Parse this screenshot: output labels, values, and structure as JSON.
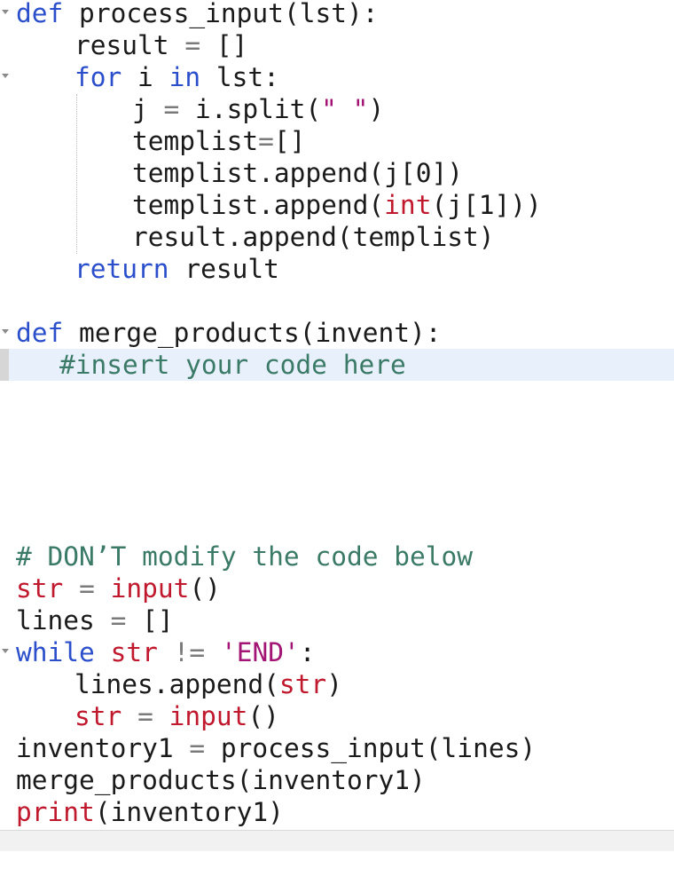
{
  "editor": {
    "lines": [
      {
        "id": 1,
        "tokens": [
          {
            "t": "kw",
            "v": "def"
          },
          {
            "t": "tx",
            "v": " process_input(lst):"
          }
        ]
      },
      {
        "id": 2,
        "tokens": [
          {
            "t": "tx",
            "v": "result "
          },
          {
            "t": "op",
            "v": "="
          },
          {
            "t": "tx",
            "v": " []"
          }
        ]
      },
      {
        "id": 3,
        "tokens": [
          {
            "t": "kw",
            "v": "for"
          },
          {
            "t": "tx",
            "v": " i "
          },
          {
            "t": "kw",
            "v": "in"
          },
          {
            "t": "tx",
            "v": " lst:"
          }
        ]
      },
      {
        "id": 4,
        "tokens": [
          {
            "t": "tx",
            "v": "j "
          },
          {
            "t": "op",
            "v": "="
          },
          {
            "t": "tx",
            "v": " i.split("
          },
          {
            "t": "str",
            "v": "\" \""
          },
          {
            "t": "tx",
            "v": ")"
          }
        ]
      },
      {
        "id": 5,
        "tokens": [
          {
            "t": "tx",
            "v": "templist"
          },
          {
            "t": "op",
            "v": "="
          },
          {
            "t": "tx",
            "v": "[]"
          }
        ]
      },
      {
        "id": 6,
        "tokens": [
          {
            "t": "tx",
            "v": "templist.append(j[0])"
          }
        ]
      },
      {
        "id": 7,
        "tokens": [
          {
            "t": "tx",
            "v": "templist.append("
          },
          {
            "t": "fn",
            "v": "int"
          },
          {
            "t": "tx",
            "v": "(j[1]))"
          }
        ]
      },
      {
        "id": 8,
        "tokens": [
          {
            "t": "tx",
            "v": "result.append(templist)"
          }
        ]
      },
      {
        "id": 9,
        "tokens": [
          {
            "t": "kw",
            "v": "return"
          },
          {
            "t": "tx",
            "v": " result"
          }
        ]
      },
      {
        "id": 10,
        "tokens": [
          {
            "t": "kw",
            "v": "def"
          },
          {
            "t": "tx",
            "v": " merge_products(invent):"
          }
        ]
      },
      {
        "id": 11,
        "tokens": [
          {
            "t": "cm",
            "v": "#insert your code here"
          }
        ]
      },
      {
        "id": 12,
        "tokens": [
          {
            "t": "cm",
            "v": "# DON’T modify the code below"
          }
        ]
      },
      {
        "id": 13,
        "tokens": [
          {
            "t": "fn",
            "v": "str"
          },
          {
            "t": "tx",
            "v": " "
          },
          {
            "t": "op",
            "v": "="
          },
          {
            "t": "tx",
            "v": " "
          },
          {
            "t": "fn",
            "v": "input"
          },
          {
            "t": "tx",
            "v": "()"
          }
        ]
      },
      {
        "id": 14,
        "tokens": [
          {
            "t": "tx",
            "v": "lines "
          },
          {
            "t": "op",
            "v": "="
          },
          {
            "t": "tx",
            "v": " []"
          }
        ]
      },
      {
        "id": 15,
        "tokens": [
          {
            "t": "kw",
            "v": "while"
          },
          {
            "t": "tx",
            "v": " "
          },
          {
            "t": "fn",
            "v": "str"
          },
          {
            "t": "tx",
            "v": " "
          },
          {
            "t": "op",
            "v": "!="
          },
          {
            "t": "tx",
            "v": " "
          },
          {
            "t": "str",
            "v": "'END'"
          },
          {
            "t": "tx",
            "v": ":"
          }
        ]
      },
      {
        "id": 16,
        "tokens": [
          {
            "t": "tx",
            "v": "lines.append("
          },
          {
            "t": "fn",
            "v": "str"
          },
          {
            "t": "tx",
            "v": ")"
          }
        ]
      },
      {
        "id": 17,
        "tokens": [
          {
            "t": "fn",
            "v": "str"
          },
          {
            "t": "tx",
            "v": " "
          },
          {
            "t": "op",
            "v": "="
          },
          {
            "t": "tx",
            "v": " "
          },
          {
            "t": "fn",
            "v": "input"
          },
          {
            "t": "tx",
            "v": "()"
          }
        ]
      },
      {
        "id": 18,
        "tokens": [
          {
            "t": "tx",
            "v": "inventory1 "
          },
          {
            "t": "op",
            "v": "="
          },
          {
            "t": "tx",
            "v": " process_input(lines)"
          }
        ]
      },
      {
        "id": 19,
        "tokens": [
          {
            "t": "tx",
            "v": "merge_products(inventory1)"
          }
        ]
      },
      {
        "id": 20,
        "tokens": [
          {
            "t": "fn",
            "v": "print"
          },
          {
            "t": "tx",
            "v": "(inventory1)"
          }
        ]
      }
    ]
  },
  "colors": {
    "keyword": "#2b4ecb",
    "builtin": "#c0182d",
    "string": "#a31574",
    "comment": "#3a7a66",
    "current_line": "#e8f0fb"
  }
}
